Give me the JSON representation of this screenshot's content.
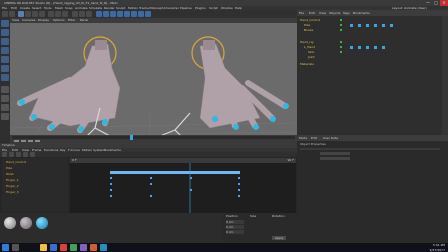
{
  "window": {
    "title": "CINEMA 4D R18.057 Studio (R) - [Hand_rigging_03_IK_F1_hand_fk_R] - Main",
    "controls": [
      "—",
      "□",
      "✕"
    ]
  },
  "menubar": {
    "items": [
      "File",
      "Edit",
      "Create",
      "Select",
      "Tools",
      "Mesh",
      "Snap",
      "Animate",
      "Simulate",
      "Render",
      "Sculpt",
      "Motion Tracker",
      "MoGraph",
      "Character",
      "Pipeline",
      "Plugins",
      "Script",
      "Window",
      "Help",
      "Layout:",
      "Animate (User)"
    ]
  },
  "viewport": {
    "menu": [
      "View",
      "Cameras",
      "Display",
      "Options",
      "Filter",
      "Panel"
    ],
    "label": "Perspective"
  },
  "timeline": {
    "title": "Timeline",
    "menu": [
      "File",
      "Edit",
      "View",
      "Frame",
      "Functions",
      "Key",
      "F-Curve",
      "Motion System",
      "Bookmarks"
    ],
    "rows": [
      "Hand_Control",
      "Pole",
      "Wrist",
      "Finger_1",
      "Finger_2",
      "Finger_3"
    ],
    "frame_start": "0 F",
    "frame_end": "90 F"
  },
  "object_manager": {
    "tabs": [
      "File",
      "Edit",
      "View",
      "Objects",
      "Tags",
      "Bookmarks"
    ],
    "items": [
      "Hand_Control",
      "Pole",
      "Bones",
      "Hand_rig",
      "L_Hand",
      "Skin",
      "Joint",
      "Materials"
    ]
  },
  "attributes": {
    "tabs": [
      "Mode",
      "Edit",
      "User Data"
    ],
    "title": "Object Properties"
  },
  "coordinates": {
    "labels": [
      "Position",
      "Size",
      "Rotation"
    ],
    "x": "0 cm",
    "y": "0 cm",
    "z": "0 cm",
    "apply": "Apply"
  },
  "taskbar": {
    "time": "5:01 PM",
    "date": "4/27/2017",
    "icon_colors": [
      "#2d7fd8",
      "#f0c040",
      "#3a6fd0",
      "#e04030",
      "#40a060",
      "#8060c0",
      "#d06030",
      "#2090c0"
    ]
  },
  "colors": {
    "viewport_bg": "#6b6b6b",
    "hand_skin": "#b0a0a8",
    "nail_accent": "#2fb8e0",
    "control_ring": "#e0a830",
    "keyframe": "#4aa0ff"
  }
}
